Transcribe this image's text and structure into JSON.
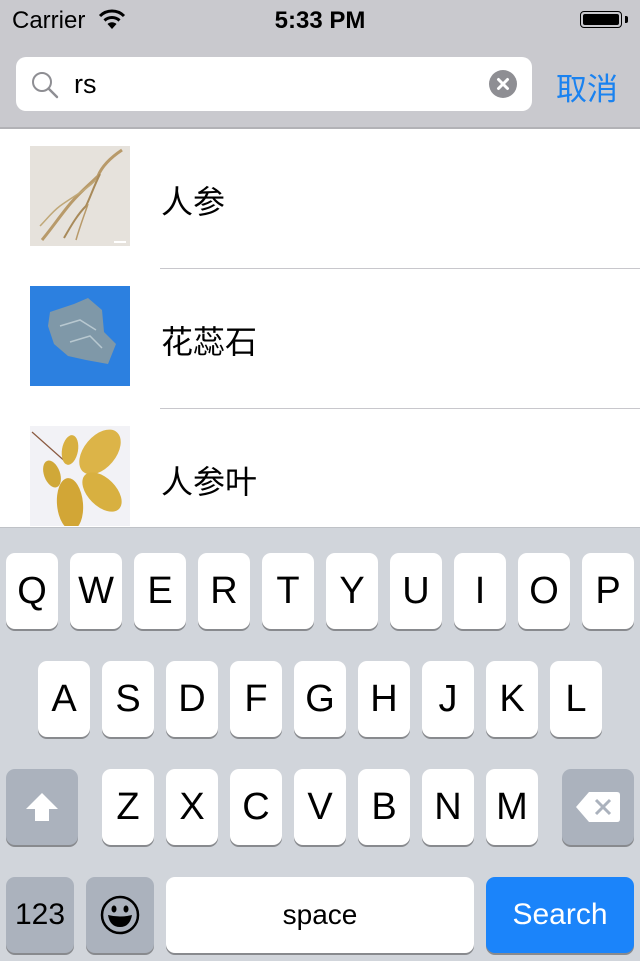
{
  "status_bar": {
    "carrier": "Carrier",
    "time": "5:33 PM",
    "battery_level": 1.0
  },
  "search": {
    "value": "rs",
    "placeholder": "",
    "cancel_label": "取消"
  },
  "results": [
    {
      "name": "人参",
      "thumbnail": "ginseng-root-image"
    },
    {
      "name": "花蕊石",
      "thumbnail": "ophicalcite-stone-image"
    },
    {
      "name": "人参叶",
      "thumbnail": "ginseng-leaf-image"
    }
  ],
  "keyboard": {
    "row1": [
      "Q",
      "W",
      "E",
      "R",
      "T",
      "Y",
      "U",
      "I",
      "O",
      "P"
    ],
    "row2": [
      "A",
      "S",
      "D",
      "F",
      "G",
      "H",
      "J",
      "K",
      "L"
    ],
    "row3": [
      "Z",
      "X",
      "C",
      "V",
      "B",
      "N",
      "M"
    ],
    "numbers_label": "123",
    "space_label": "space",
    "return_label": "Search",
    "shift_icon": "shift-arrow-icon",
    "delete_icon": "backspace-icon",
    "emoji_icon": "emoji-smiley-icon"
  },
  "colors": {
    "accent": "#1a82f0",
    "search_key": "#1b84fa",
    "header_bg": "#c9c9ce",
    "keyboard_bg": "#d1d5db"
  }
}
